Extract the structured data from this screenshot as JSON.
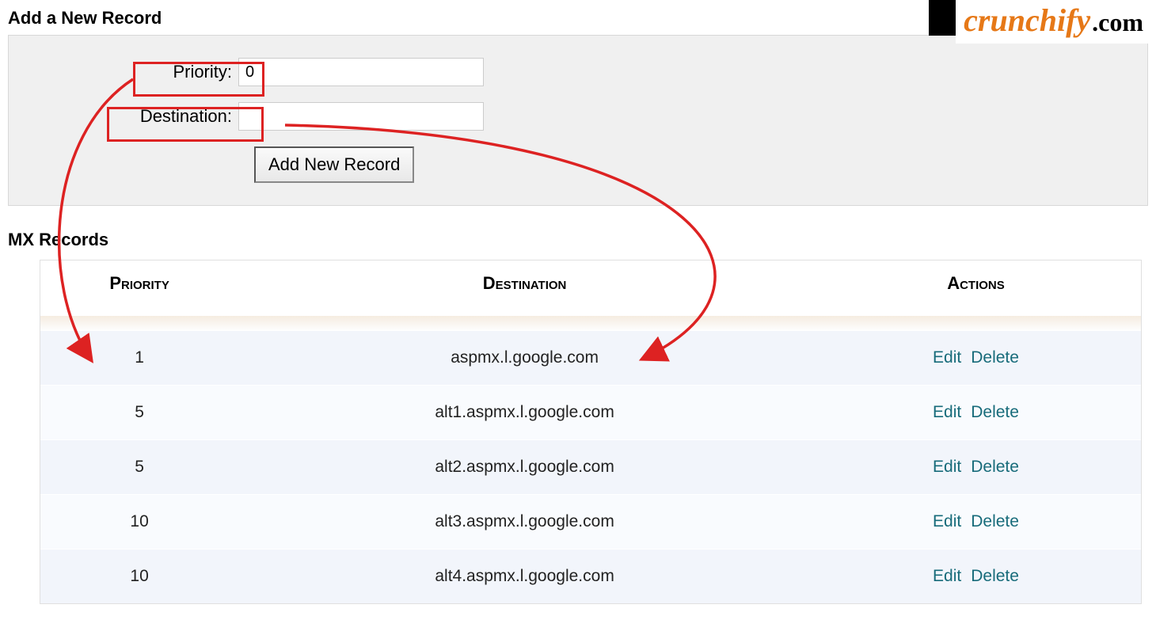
{
  "logo": {
    "brand": "crunchify",
    "suffix": ".com"
  },
  "form": {
    "title": "Add a New Record",
    "priority_label": "Priority:",
    "priority_value": "0",
    "destination_label": "Destination:",
    "destination_value": "",
    "button_label": "Add New Record"
  },
  "table": {
    "title": "MX Records",
    "columns": {
      "priority": "Priority",
      "destination": "Destination",
      "actions": "Actions"
    },
    "action_edit": "Edit",
    "action_delete": "Delete",
    "rows": [
      {
        "priority": "1",
        "destination": "aspmx.l.google.com"
      },
      {
        "priority": "5",
        "destination": "alt1.aspmx.l.google.com"
      },
      {
        "priority": "5",
        "destination": "alt2.aspmx.l.google.com"
      },
      {
        "priority": "10",
        "destination": "alt3.aspmx.l.google.com"
      },
      {
        "priority": "10",
        "destination": "alt4.aspmx.l.google.com"
      }
    ]
  }
}
